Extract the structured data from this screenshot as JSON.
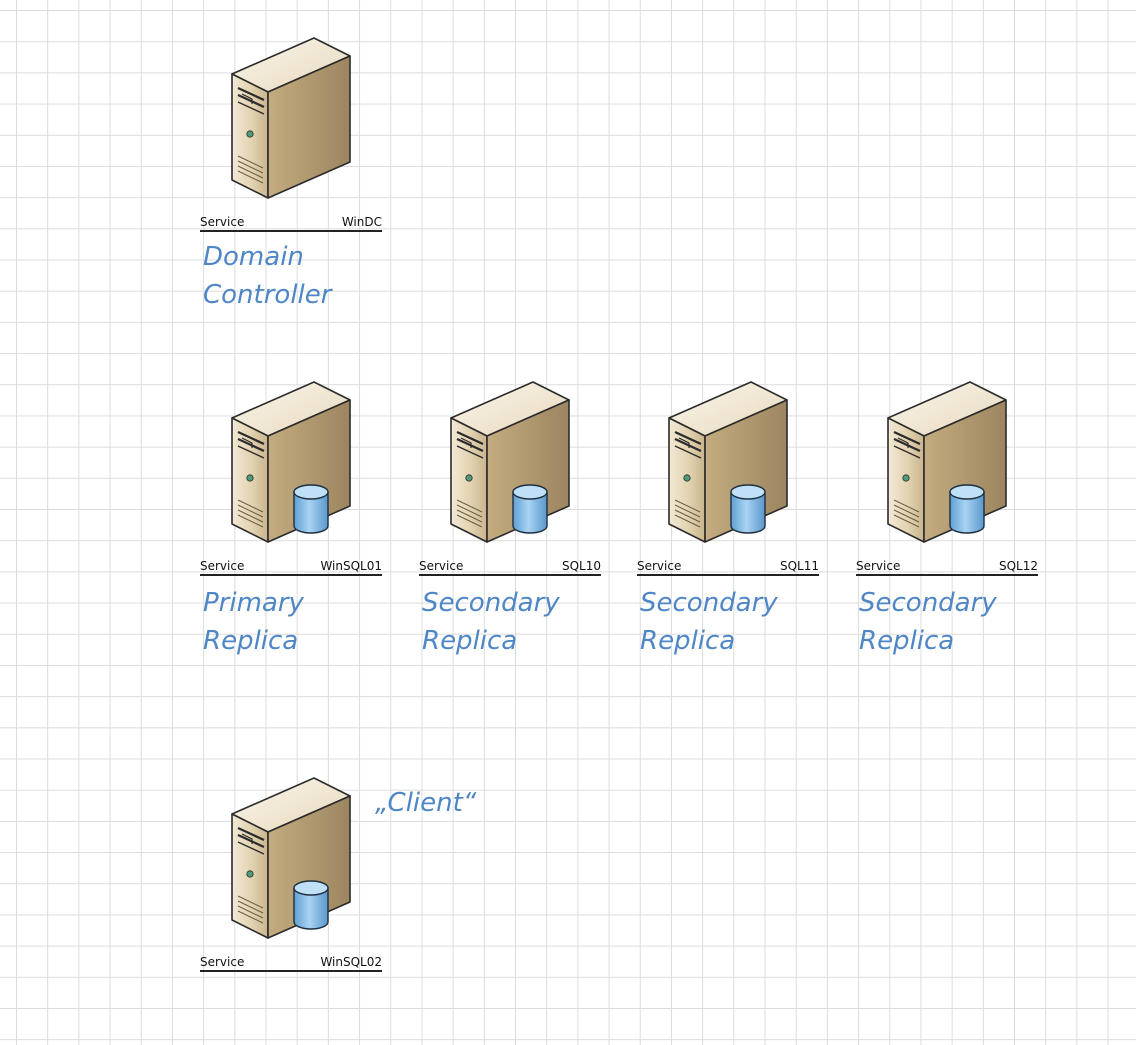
{
  "servers": [
    {
      "service": "Service",
      "name": "WinDC",
      "role_line1": "Domain",
      "role_line2": "Controller",
      "database": false
    },
    {
      "service": "Service",
      "name": "WinSQL01",
      "role_line1": "Primary",
      "role_line2": "Replica",
      "database": true
    },
    {
      "service": "Service",
      "name": "SQL10",
      "role_line1": "Secondary",
      "role_line2": "Replica",
      "database": true
    },
    {
      "service": "Service",
      "name": "SQL11",
      "role_line1": "Secondary",
      "role_line2": "Replica",
      "database": true
    },
    {
      "service": "Service",
      "name": "SQL12",
      "role_line1": "Secondary",
      "role_line2": "Replica",
      "database": true
    },
    {
      "service": "Service",
      "name": "WinSQL02",
      "role_line1": "„Client“",
      "role_line2": "",
      "database": true
    }
  ],
  "colors": {
    "role_text": "#4f86c6",
    "grid": "#dcdcdc",
    "server_body": "#e4d5b4",
    "database": "#7fb6e0"
  },
  "icons": {
    "server": "server-tower-icon",
    "database": "database-cylinder-icon"
  }
}
